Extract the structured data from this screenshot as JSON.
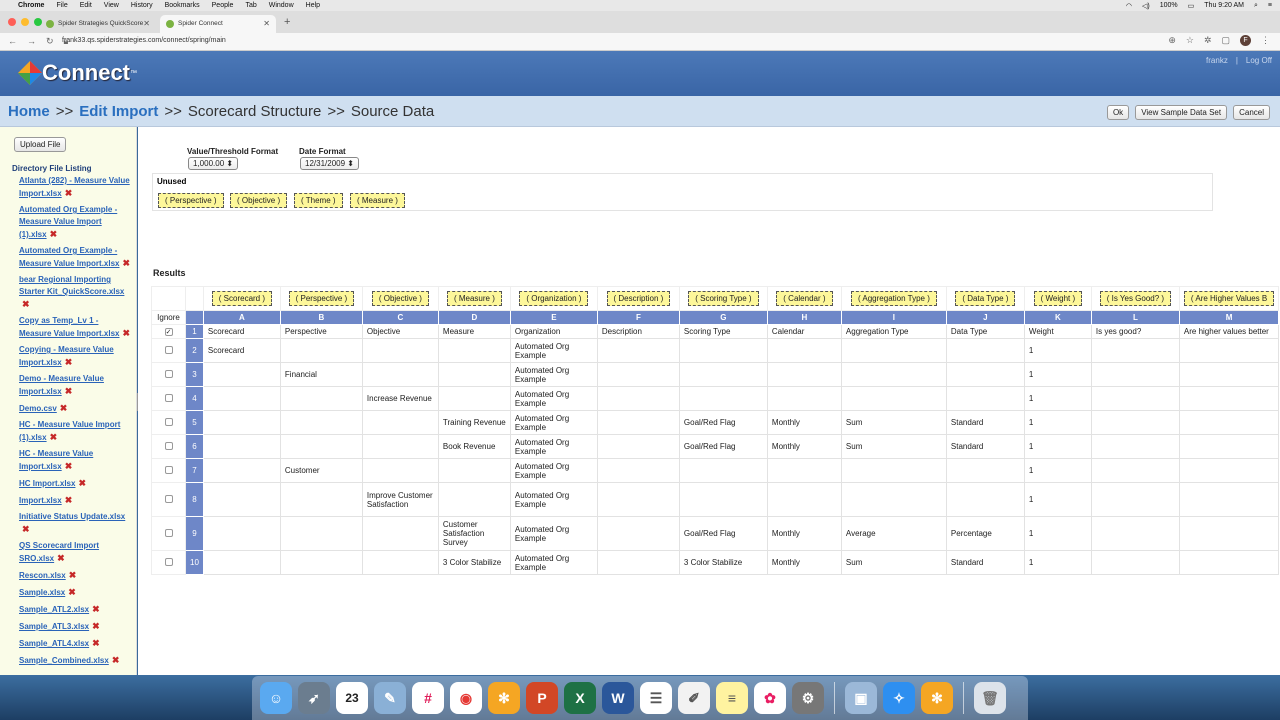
{
  "mac_menubar": {
    "app": "Chrome",
    "menus": [
      "File",
      "Edit",
      "View",
      "History",
      "Bookmarks",
      "People",
      "Tab",
      "Window",
      "Help"
    ],
    "battery": "100%",
    "clock": "Thu 9:20 AM"
  },
  "browser": {
    "tabs": [
      {
        "title": "Spider Strategies QuickScore"
      },
      {
        "title": "Spider Connect"
      }
    ],
    "url": "frank33.qs.spiderstrategies.com/connect/spring/main",
    "profile_initial": "F"
  },
  "app": {
    "logo_text": "Connect",
    "logo_tm": "™",
    "user": "frankz",
    "separator": "|",
    "logout": "Log Off"
  },
  "breadcrumb": {
    "home": "Home",
    "sep": ">>",
    "edit_import": "Edit Import",
    "scorecard_structure": "Scorecard Structure",
    "source_data": "Source Data"
  },
  "actions": {
    "ok": "Ok",
    "view_sample": "View Sample Data Set",
    "cancel": "Cancel"
  },
  "sidebar": {
    "upload_button": "Upload File",
    "directory_title": "Directory File Listing",
    "delete_glyph": "✖",
    "files": [
      "Atlanta (282) - Measure Value Import.xlsx",
      "Automated Org Example - Measure Value Import (1).xlsx",
      "Automated Org Example - Measure Value Import.xlsx",
      "bear Regional Importing Starter Kit_QuickScore.xlsx",
      "Copy as Temp_Lv 1 - Measure Value Import.xlsx",
      "Copying - Measure Value Import.xlsx",
      "Demo - Measure Value Import.xlsx",
      "Demo.csv",
      "HC - Measure Value Import (1).xlsx",
      "HC - Measure Value Import.xlsx",
      "HC Import.xlsx",
      "Import.xlsx",
      "Initiative Status Update.xlsx",
      "QS Scorecard Import SRO.xlsx",
      "Rescon.xlsx",
      "Sample.xlsx",
      "Sample_ATL2.xlsx",
      "Sample_ATL3.xlsx",
      "Sample_ATL4.xlsx",
      "Sample_Combined.xlsx"
    ]
  },
  "formats": {
    "value_label": "Value/Threshold Format",
    "value_selected": "1,000.00",
    "date_label": "Date Format",
    "date_selected": "12/31/2009"
  },
  "unused": {
    "label": "Unused",
    "chips": [
      "( Perspective )",
      "( Objective )",
      "( Theme )",
      "( Measure )"
    ]
  },
  "results": {
    "label": "Results",
    "ignore_label": "Ignore",
    "column_chips": [
      "( Scorecard )",
      "( Perspective )",
      "( Objective )",
      "( Measure )",
      "( Organization )",
      "( Description )",
      "( Scoring Type )",
      "( Calendar )",
      "( Aggregation Type )",
      "( Data Type )",
      "( Weight )",
      "( Is Yes Good? )",
      "( Are Higher Values B"
    ],
    "column_letters": [
      "A",
      "B",
      "C",
      "D",
      "E",
      "F",
      "G",
      "H",
      "I",
      "J",
      "K",
      "L",
      "M"
    ],
    "rows": [
      {
        "n": "1",
        "checked": true,
        "cells": [
          "Scorecard",
          "Perspective",
          "Objective",
          "Measure",
          "Organization",
          "Description",
          "Scoring Type",
          "Calendar",
          "Aggregation Type",
          "Data Type",
          "Weight",
          "Is yes good?",
          "Are higher values better"
        ]
      },
      {
        "n": "2",
        "checked": false,
        "cells": [
          "Scorecard",
          "",
          "",
          "",
          "Automated Org Example",
          "",
          "",
          "",
          "",
          "",
          "1",
          "",
          ""
        ]
      },
      {
        "n": "3",
        "checked": false,
        "cells": [
          "",
          "Financial",
          "",
          "",
          "Automated Org Example",
          "",
          "",
          "",
          "",
          "",
          "1",
          "",
          ""
        ]
      },
      {
        "n": "4",
        "checked": false,
        "cells": [
          "",
          "",
          "Increase Revenue",
          "",
          "Automated Org Example",
          "",
          "",
          "",
          "",
          "",
          "1",
          "",
          ""
        ]
      },
      {
        "n": "5",
        "checked": false,
        "cells": [
          "",
          "",
          "",
          "Training Revenue",
          "Automated Org Example",
          "",
          "Goal/Red Flag",
          "Monthly",
          "Sum",
          "Standard",
          "1",
          "",
          ""
        ]
      },
      {
        "n": "6",
        "checked": false,
        "cells": [
          "",
          "",
          "",
          "Book Revenue",
          "Automated Org Example",
          "",
          "Goal/Red Flag",
          "Monthly",
          "Sum",
          "Standard",
          "1",
          "",
          ""
        ]
      },
      {
        "n": "7",
        "checked": false,
        "cells": [
          "",
          "Customer",
          "",
          "",
          "Automated Org Example",
          "",
          "",
          "",
          "",
          "",
          "1",
          "",
          ""
        ]
      },
      {
        "n": "8",
        "checked": false,
        "cells": [
          "",
          "",
          "Improve Customer Satisfaction",
          "",
          "Automated Org Example",
          "",
          "",
          "",
          "",
          "",
          "1",
          "",
          ""
        ]
      },
      {
        "n": "9",
        "checked": false,
        "cells": [
          "",
          "",
          "",
          "Customer Satisfaction Survey",
          "Automated Org Example",
          "",
          "Goal/Red Flag",
          "Monthly",
          "Average",
          "Percentage",
          "1",
          "",
          ""
        ]
      },
      {
        "n": "10",
        "checked": false,
        "cells": [
          "",
          "",
          "",
          "3 Color Stabilize",
          "Automated Org Example",
          "",
          "3 Color Stabilize",
          "Monthly",
          "Sum",
          "Standard",
          "1",
          "",
          ""
        ]
      }
    ]
  },
  "dock": {
    "calendar_day": "23",
    "items": [
      "finder-icon",
      "launchpad-icon",
      "calendar-icon",
      "preview-icon",
      "slack-icon",
      "chrome-icon",
      "quickscore-icon",
      "powerpoint-icon",
      "excel-icon",
      "word-icon",
      "lists-icon",
      "textedit-icon",
      "notes-icon",
      "photos-icon",
      "system-preferences-icon",
      "screenshot-icon",
      "safari-icon",
      "quickscore-2-icon",
      "trash-icon"
    ]
  }
}
